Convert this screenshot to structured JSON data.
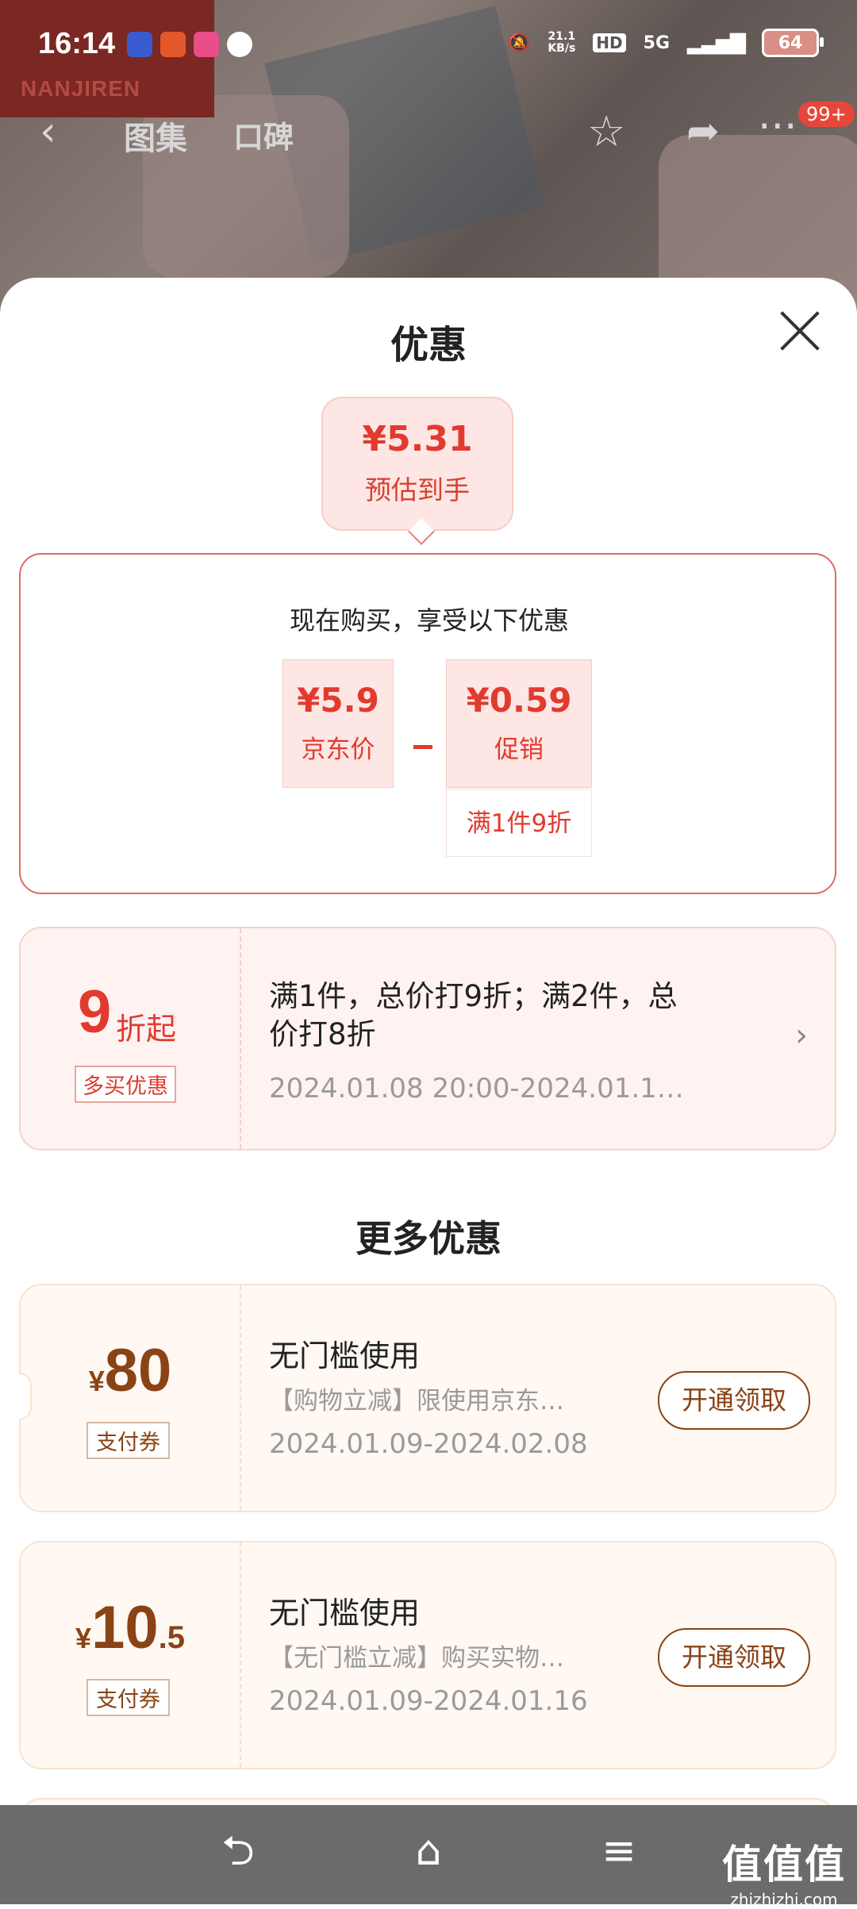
{
  "status_bar": {
    "time": "16:14",
    "net_speed": "21.1\nKB/s",
    "net_speed_top": "21.1",
    "net_speed_unit": "KB/s",
    "hd": "HD",
    "network": "5G",
    "battery": "64"
  },
  "header": {
    "tabs": [
      "图集",
      "口碑"
    ],
    "badge": "99+",
    "brand": "NANJIREN"
  },
  "sheet": {
    "title": "优惠",
    "estimate": {
      "price": "¥5.31",
      "label": "预估到手"
    },
    "detail": {
      "subtitle": "现在购买，享受以下优惠",
      "jd_price": {
        "value": "¥5.9",
        "label": "京东价"
      },
      "promo": {
        "value": "¥0.59",
        "label": "促销"
      },
      "promo_tag": "满1件9折"
    },
    "multi_buy": {
      "big": "9",
      "big_suffix": "折起",
      "tag": "多买优惠",
      "desc": "满1件，总价打9折；满2件，总价打8折",
      "date": "2024.01.08 20:00-2024.01.1…"
    },
    "more_title": "更多优惠",
    "coupons": [
      {
        "currency": "¥",
        "amount_int": "80",
        "amount_dec": "",
        "tag": "支付券",
        "title": "无门槛使用",
        "desc": "【购物立减】限使用京东…",
        "date": "2024.01.09-2024.02.08",
        "button": "开通领取"
      },
      {
        "currency": "¥",
        "amount_int": "10",
        "amount_dec": ".5",
        "tag": "支付券",
        "title": "无门槛使用",
        "desc": "【无门槛立减】购买实物…",
        "date": "2024.01.09-2024.01.16",
        "button": "开通领取"
      }
    ]
  },
  "watermark": {
    "main": "值值值",
    "sub": "zhizhizhi.com"
  },
  "colors": {
    "accent_red": "#e23a2e",
    "coupon_brown": "#8a4315",
    "nav_gray": "#6b6b6b"
  }
}
